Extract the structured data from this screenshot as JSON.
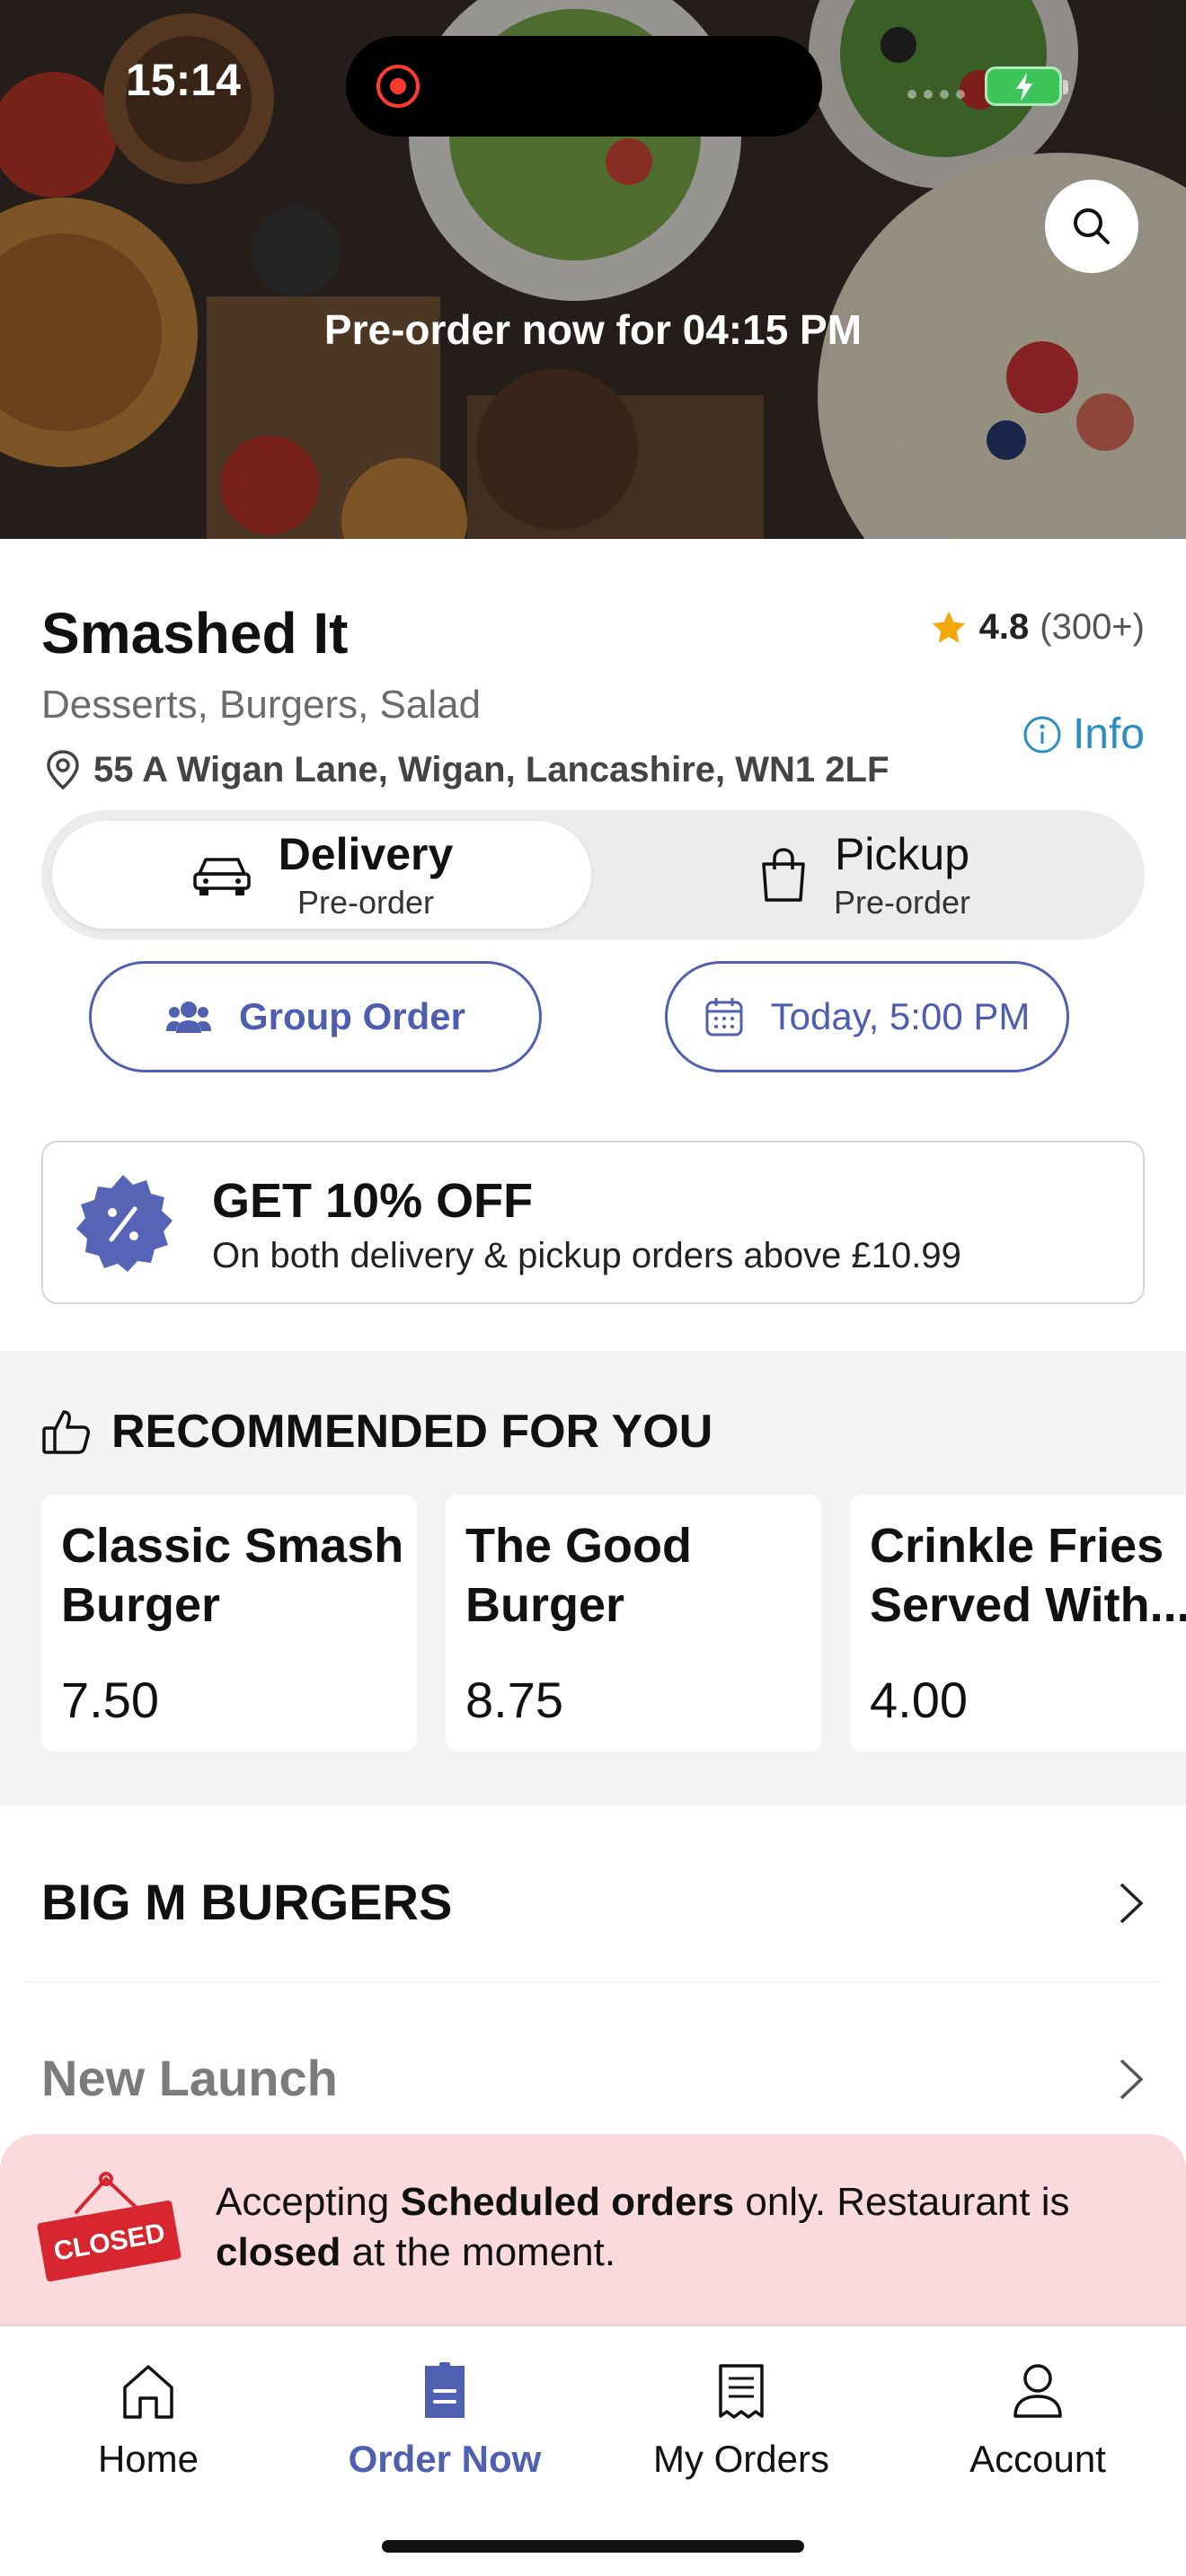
{
  "status_bar": {
    "time": "15:14"
  },
  "hero": {
    "banner_text": "Pre-order now for 04:15 PM",
    "search_icon": "search-icon"
  },
  "restaurant": {
    "name": "Smashed It",
    "rating": "4.8",
    "rating_count": "(300+)",
    "cuisines": "Desserts, Burgers, Salad",
    "address": "55 A Wigan Lane, Wigan, Lancashire, WN1 2LF",
    "info_label": "Info"
  },
  "order_mode": {
    "options": [
      {
        "label": "Delivery",
        "sub": "Pre-order",
        "icon": "car-icon",
        "selected": true
      },
      {
        "label": "Pickup",
        "sub": "Pre-order",
        "icon": "shopping-bag-icon",
        "selected": false
      }
    ]
  },
  "actions": {
    "group_order": "Group Order",
    "schedule": "Today, 5:00 PM"
  },
  "offer": {
    "title": "GET 10% OFF",
    "subtitle": "On both delivery & pickup orders above £10.99",
    "icon": "discount-badge-icon"
  },
  "recommended": {
    "heading": "RECOMMENDED FOR YOU",
    "items": [
      {
        "name": "Classic Smash Burger",
        "price": "7.50"
      },
      {
        "name": "The Good Burger",
        "price": "8.75"
      },
      {
        "name": "Crinkle Fries Served With...",
        "price": "4.00"
      }
    ]
  },
  "categories": [
    "BIG M BURGERS",
    "New Launch"
  ],
  "closed_notice": {
    "sign_text": "CLOSED",
    "part1": "Accepting ",
    "bold1": "Scheduled orders",
    "part2": " only. Restaurant is ",
    "bold2": "closed",
    "part3": " at the moment."
  },
  "tab_bar": {
    "tabs": [
      {
        "label": "Home",
        "icon": "home-icon"
      },
      {
        "label": "Order Now",
        "icon": "order-now-icon",
        "active": true
      },
      {
        "label": "My Orders",
        "icon": "receipt-icon"
      },
      {
        "label": "Account",
        "icon": "account-icon"
      }
    ]
  },
  "colors": {
    "accent": "#5060b0",
    "info": "#2b8fc4",
    "closed_bg": "#fadadd",
    "closed_sign": "#d7262f",
    "star": "#f4a90a"
  }
}
